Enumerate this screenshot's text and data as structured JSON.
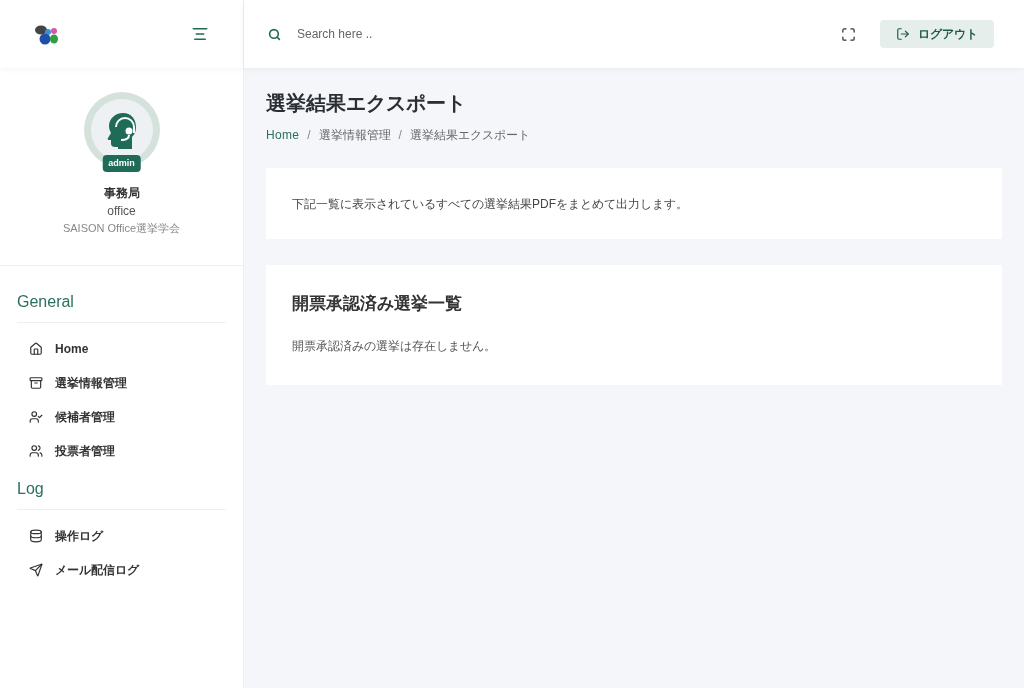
{
  "header": {
    "search": {
      "placeholder": "Search here .."
    },
    "logout_button": "ログアウト"
  },
  "profile": {
    "badge": "admin",
    "name": "事務局",
    "role": "office",
    "organization": "SAISON Office選挙学会"
  },
  "sidebar": {
    "sections": [
      {
        "title": "General",
        "items": [
          {
            "label": "Home"
          },
          {
            "label": "選挙情報管理"
          },
          {
            "label": "候補者管理"
          },
          {
            "label": "投票者管理"
          }
        ]
      },
      {
        "title": "Log",
        "items": [
          {
            "label": "操作ログ"
          },
          {
            "label": "メール配信ログ"
          }
        ]
      }
    ]
  },
  "page": {
    "title": "選挙結果エクスポート",
    "breadcrumb": [
      "Home",
      "選挙情報管理",
      "選挙結果エクスポート"
    ],
    "breadcrumb_separator": "/",
    "intro": "下記一覧に表示されているすべての選挙結果PDFをまとめて出力します。",
    "list_card": {
      "title": "開票承認済み選挙一覧",
      "empty_message": "開票承認済みの選挙は存在しません。"
    }
  }
}
